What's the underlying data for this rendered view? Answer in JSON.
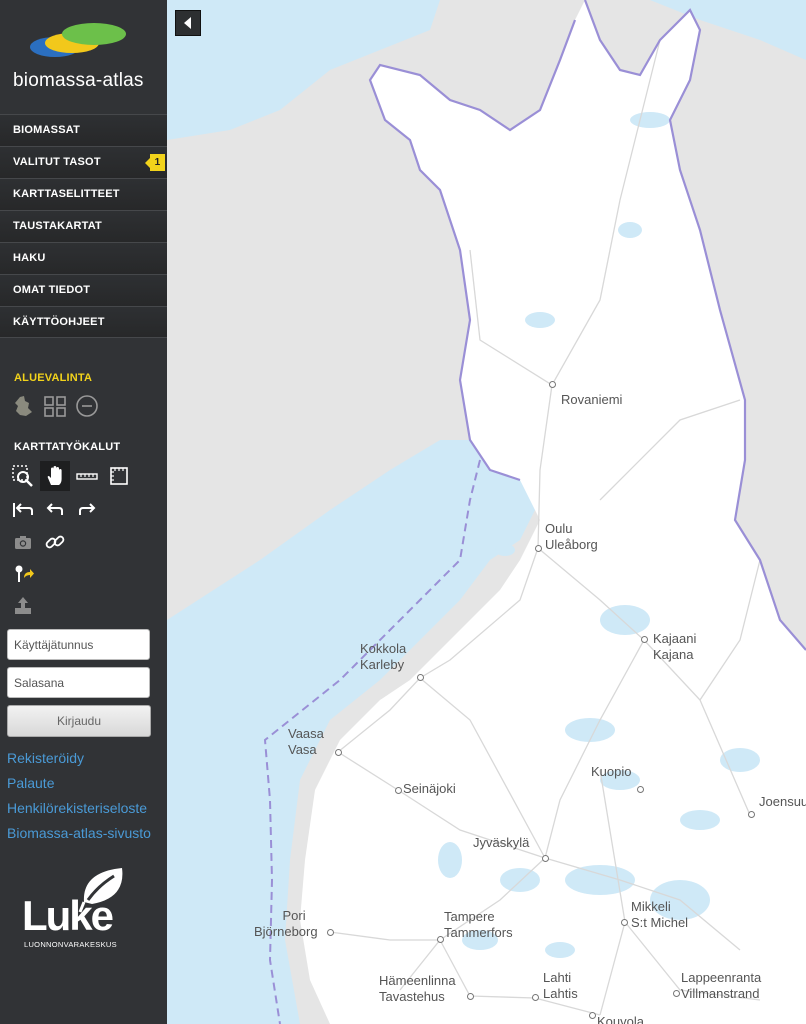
{
  "app": {
    "logo_text": "biomassa-atlas"
  },
  "menu": {
    "items": [
      {
        "label": "BIOMASSAT"
      },
      {
        "label": "VALITUT TASOT",
        "badge": "1"
      },
      {
        "label": "KARTTASELITTEET"
      },
      {
        "label": "TAUSTAKARTAT"
      },
      {
        "label": "HAKU"
      },
      {
        "label": "OMAT TIEDOT"
      },
      {
        "label": "KÄYTTÖOHJEET"
      }
    ]
  },
  "area_selection": {
    "title": "ALUEVALINTA",
    "tools": [
      "finland-region-icon",
      "grid-select-icon",
      "circle-select-icon"
    ]
  },
  "map_tools": {
    "title": "KARTTATYÖKALUT",
    "tools": [
      "zoom-box-icon",
      "pan-hand-icon",
      "measure-ruler-icon",
      "area-measure-icon",
      "zoom-extent-icon",
      "undo-icon",
      "redo-icon",
      "camera-icon",
      "link-icon",
      "pin-share-icon",
      "upload-icon"
    ]
  },
  "login": {
    "username_placeholder": "Käyttäjätunnus",
    "password_placeholder": "Salasana",
    "submit_label": "Kirjaudu"
  },
  "links": [
    "Rekisteröidy",
    "Palaute",
    "Henkilörekisteriseloste",
    "Biomassa-atlas-sivusto"
  ],
  "brand": {
    "name": "Luke",
    "subtitle": "LUONNONVARAKESKUS"
  },
  "map": {
    "cities": [
      {
        "name": "Rovaniemi"
      },
      {
        "name": "Oulu",
        "alt": "Uleåborg"
      },
      {
        "name": "Kajaani",
        "alt": "Kajana"
      },
      {
        "name": "Kokkola",
        "alt": "Karleby"
      },
      {
        "name": "Vaasa",
        "alt": "Vasa"
      },
      {
        "name": "Seinäjoki"
      },
      {
        "name": "Kuopio"
      },
      {
        "name": "Joensuu"
      },
      {
        "name": "Jyväskylä"
      },
      {
        "name": "Pori",
        "alt": "Björneborg"
      },
      {
        "name": "Tampere",
        "alt": "Tammerfors"
      },
      {
        "name": "Mikkeli",
        "alt": "S:t Michel"
      },
      {
        "name": "Hämeenlinna",
        "alt": "Tavastehus"
      },
      {
        "name": "Lahti",
        "alt": "Lahtis"
      },
      {
        "name": "Lappeenranta",
        "alt": "Villmanstrand"
      },
      {
        "name": "Kouvola"
      }
    ]
  },
  "colors": {
    "sidebar": "#313336",
    "accent_yellow": "#f2d31b",
    "link_blue": "#4a9ad6",
    "land": "#ffffff",
    "water": "#cfe9f7",
    "foreign_land": "#e5e5e5",
    "border": "#9a8fd6"
  }
}
